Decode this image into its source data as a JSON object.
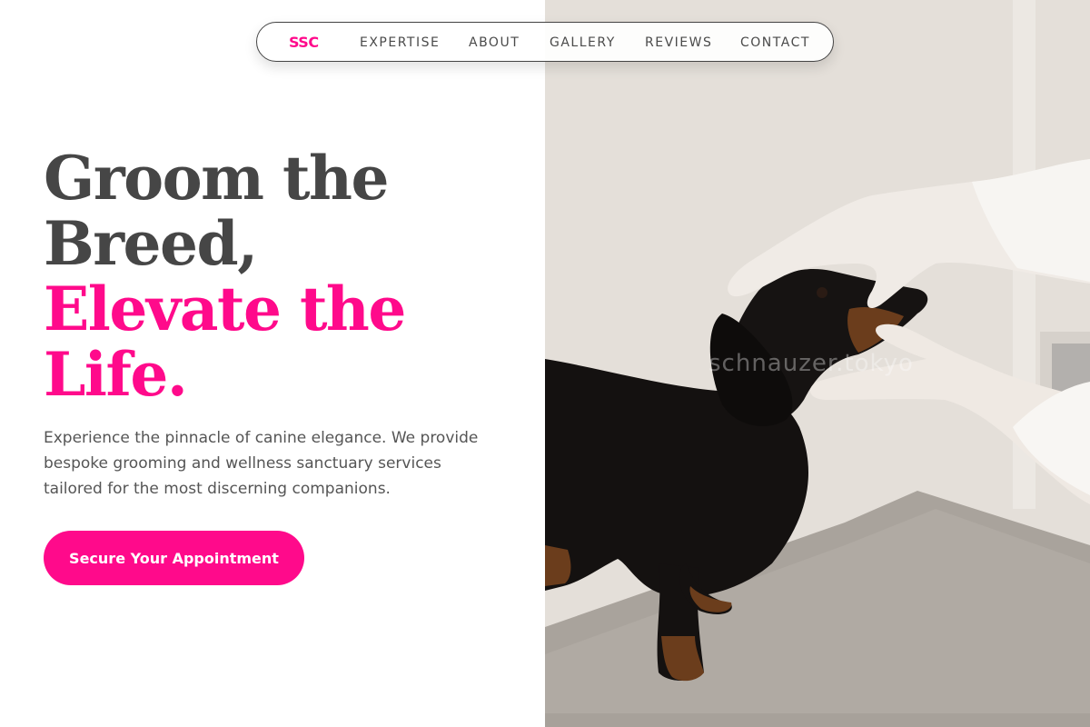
{
  "nav": {
    "brand": "SSC",
    "items": [
      "EXPERTISE",
      "ABOUT",
      "GALLERY",
      "REVIEWS",
      "CONTACT"
    ]
  },
  "hero": {
    "headline_dark_1": "Groom the",
    "headline_dark_2": "Breed,",
    "headline_pink_1": "Elevate the",
    "headline_pink_2": "Life.",
    "lead": "Experience the pinnacle of canine elegance. We provide bespoke grooming and wellness sanctuary services tailored for the most discerning companions.",
    "cta_label": "Secure Your Appointment"
  },
  "image": {
    "watermark": "schnauzer.tokyo"
  },
  "colors": {
    "accent": "#ff0a8b",
    "headline": "#464646",
    "body_text": "#555555"
  }
}
